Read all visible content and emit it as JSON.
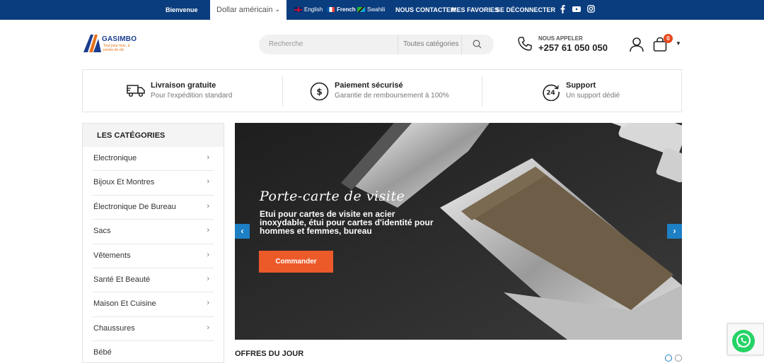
{
  "topbar": {
    "welcome": "Bienvenue",
    "currency": "Dollar américain",
    "languages": [
      {
        "label": "English",
        "flag": "uk"
      },
      {
        "label": "French",
        "flag": "fr"
      },
      {
        "label": "Swahili",
        "flag": "tz"
      }
    ],
    "links": [
      "NOUS CONTACTER",
      "MES FAVORIES",
      "SE DÉCONNECTER"
    ],
    "social": [
      "facebook-icon",
      "youtube-icon",
      "instagram-icon"
    ],
    "bg_color": "#0a3d7e"
  },
  "header": {
    "logo_name": "GASIMBO",
    "logo_tagline": "Tout pour tous, à portée de clic",
    "search_placeholder": "Recherche",
    "search_category": "Toutes catégories",
    "call_label": "NOUS APPELER",
    "call_number": "+257 61 050 050",
    "cart_count": "0"
  },
  "features": [
    {
      "title": "Livraison gratuite",
      "subtitle": "Pour l'expédition standard",
      "icon": "truck-icon"
    },
    {
      "title": "Paiement sécurisé",
      "subtitle": "Garantie de remboursement à 100%",
      "icon": "dollar-circle-icon"
    },
    {
      "title": "Support",
      "subtitle": "Un support dédié",
      "icon": "support-24-icon"
    }
  ],
  "categories": {
    "heading": "LES CATÉGORIES",
    "items": [
      "Electronique",
      "Bijoux Et Montres",
      "Électronique De Bureau",
      "Sacs",
      "Vêtements",
      "Santé Et Beauté",
      "Maison Et Cuisine",
      "Chaussures",
      "Bébé"
    ]
  },
  "banner": {
    "title": "Porte-carte de visite",
    "description": "Etui pour cartes de visite en acier inoxydable, étui pour cartes d'identité pour hommes et femmes, bureau",
    "button": "Commander",
    "accent": "#ec5a2a"
  },
  "deals": {
    "heading": "OFFRES DU JOUR"
  }
}
